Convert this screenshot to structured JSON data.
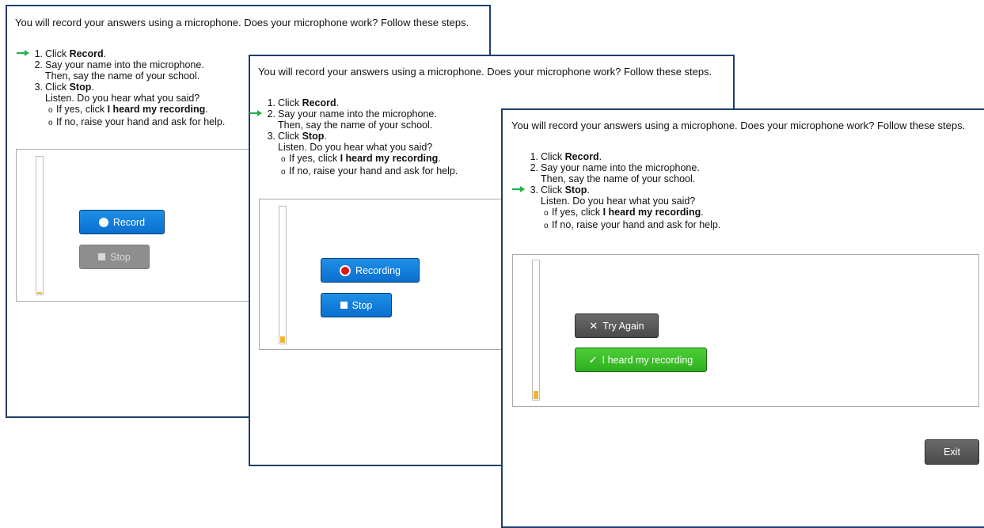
{
  "intro_text": "You will record your answers using a microphone. Does your microphone work? Follow these steps.",
  "steps": {
    "step1_prefix": "Click ",
    "step1_bold": "Record",
    "step2_line1": "Say your name into the microphone.",
    "step2_line2": "Then, say the name of your school.",
    "step3_prefix": "Click ",
    "step3_bold": "Stop",
    "listen": "Listen. Do you hear what you said?",
    "yes_prefix": "If yes, click ",
    "yes_bold": "I heard my recording",
    "no_text": "If no, raise your hand and ask for help."
  },
  "panel1": {
    "record_label": "Record",
    "stop_label": "Stop"
  },
  "panel2": {
    "recording_label": "Recording",
    "stop_label": "Stop"
  },
  "panel3": {
    "try_again_label": "Try Again",
    "heard_label": "I heard my recording",
    "exit_label": "Exit"
  },
  "colors": {
    "border": "#1f3f6b",
    "accent_blue": "#0a6fcf",
    "accent_green": "#2fb01f",
    "arrow_green": "#22b14c",
    "meter_level": "#f0b429"
  }
}
